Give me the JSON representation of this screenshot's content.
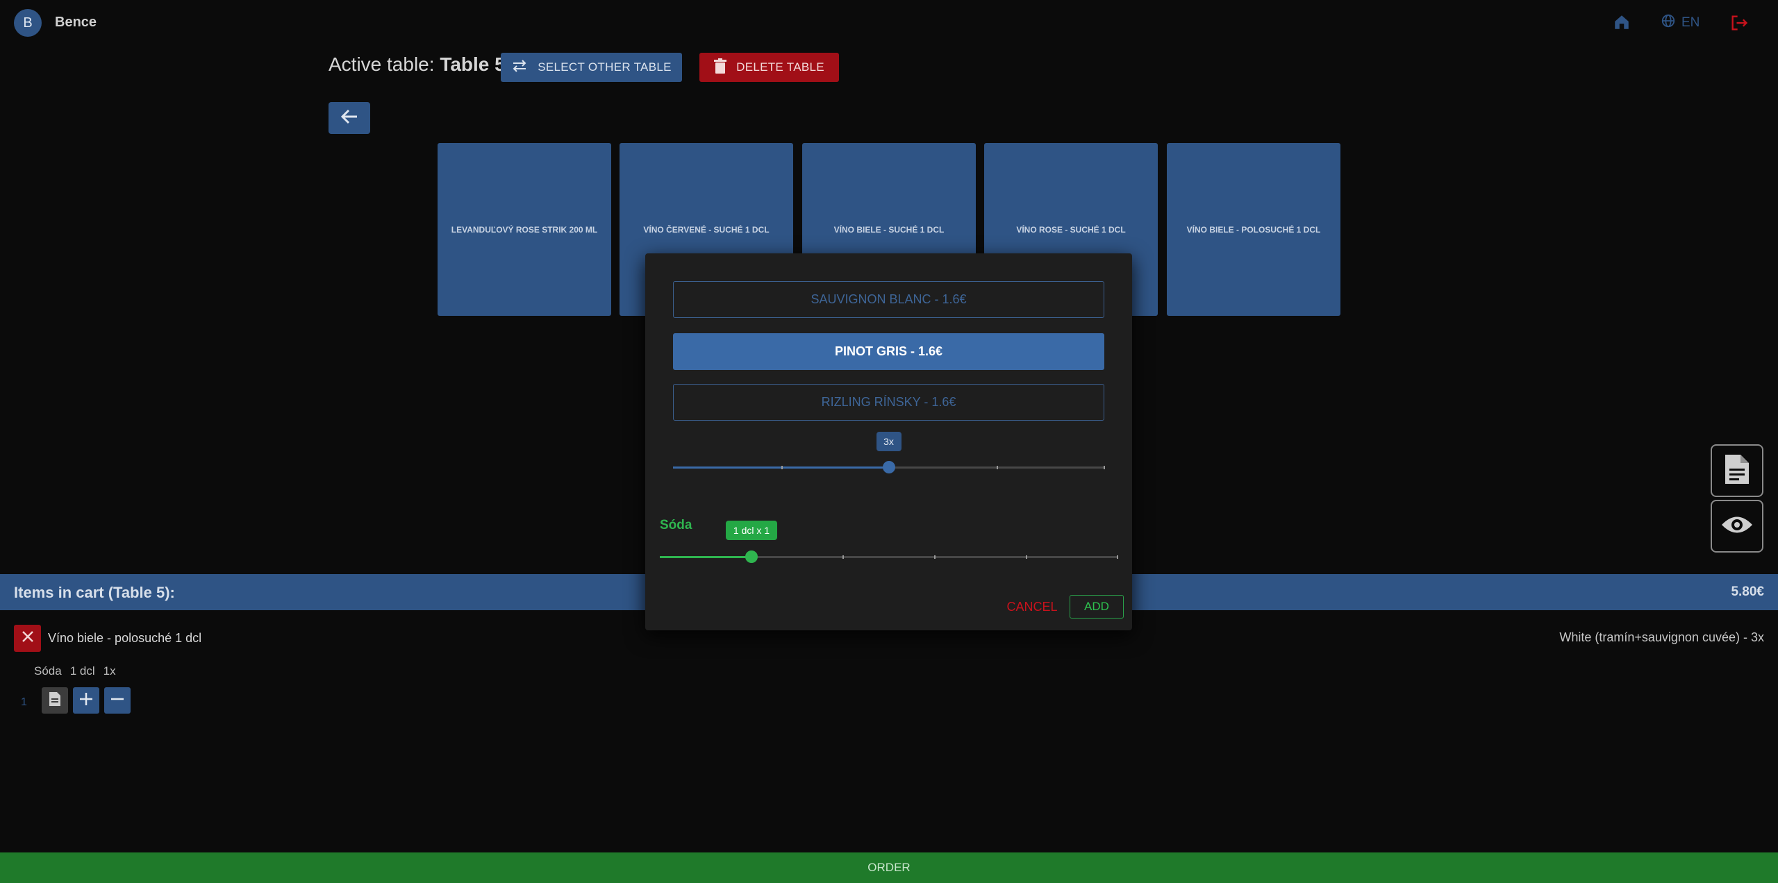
{
  "user": {
    "initial": "B",
    "name": "Bence"
  },
  "top_bar": {
    "language": "EN"
  },
  "header": {
    "active_prefix": "Active table:",
    "active_table": "Table 5",
    "select_label": "SELECT OTHER TABLE",
    "delete_label": "DELETE TABLE"
  },
  "products": [
    "LEVANDUĽOVÝ ROSE STRIK 200 ML",
    "VÍNO ČERVENÉ - SUCHÉ 1 DCL",
    "VÍNO BIELE - SUCHÉ 1 DCL",
    "VÍNO ROSE - SUCHÉ 1 DCL",
    "VÍNO BIELE - POLOSUCHÉ 1 DCL"
  ],
  "modal": {
    "options": [
      {
        "label": "SAUVIGNON BLANC - 1.6€",
        "selected": false
      },
      {
        "label": "PINOT GRIS - 1.6€",
        "selected": true
      },
      {
        "label": "RIZLING RÍNSKY - 1.6€",
        "selected": false
      }
    ],
    "quantity_slider": {
      "value_label": "3x",
      "fraction": 0.5,
      "color": "#3a6aa7"
    },
    "soda": {
      "label": "Sóda",
      "value_label": "1 dcl x 1",
      "fraction": 0.2,
      "color": "#2fb54f"
    },
    "cancel_label": "CANCEL",
    "add_label": "ADD"
  },
  "cart": {
    "title": "Items in cart (Table 5):",
    "total": "5.80€",
    "items": [
      {
        "name": "Víno biele - polosuché 1 dcl",
        "description": "White (tramín+sauvignon cuvée) - 3x",
        "modifier": {
          "name": "Sóda",
          "size": "1 dcl",
          "qty": "1x"
        },
        "index": "1"
      }
    ]
  },
  "order_label": "ORDER",
  "colors": {
    "primary": "#2f5485",
    "danger": "#a10f17",
    "success": "#1f7a2a",
    "background": "#0b0b0b"
  }
}
